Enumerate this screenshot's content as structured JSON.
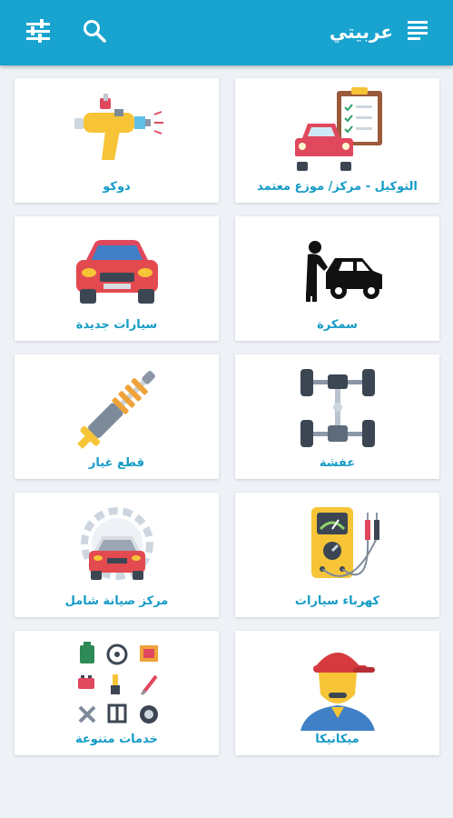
{
  "app": {
    "title": "عربيتي"
  },
  "toolbar": {
    "filter_icon": "tune-sliders-icon",
    "search_icon": "search-icon",
    "menu_icon": "menu-lines-icon"
  },
  "categories": [
    {
      "label": "دوكو",
      "icon": "spray-paint-gun-icon"
    },
    {
      "label": "التوكيل - مركز/ موزع معتمد",
      "icon": "car-clipboard-checklist-icon"
    },
    {
      "label": "سيارات جديدة",
      "icon": "red-car-front-icon"
    },
    {
      "label": "سمكرة",
      "icon": "mechanic-fixing-car-icon"
    },
    {
      "label": "قطع غيار",
      "icon": "shock-absorber-icon"
    },
    {
      "label": "عفشة",
      "icon": "car-chassis-axle-icon"
    },
    {
      "label": "مركز صيانة شامل",
      "icon": "car-gear-maintenance-icon"
    },
    {
      "label": "كهرباء سيارات",
      "icon": "multimeter-icon"
    },
    {
      "label": "خدمات متنوعة",
      "icon": "assorted-services-icon"
    },
    {
      "label": "ميكانيكا",
      "icon": "mechanic-cap-icon"
    }
  ],
  "colors": {
    "accent": "#18a4cf",
    "label": "#149bc6",
    "background": "#eef2f7"
  }
}
